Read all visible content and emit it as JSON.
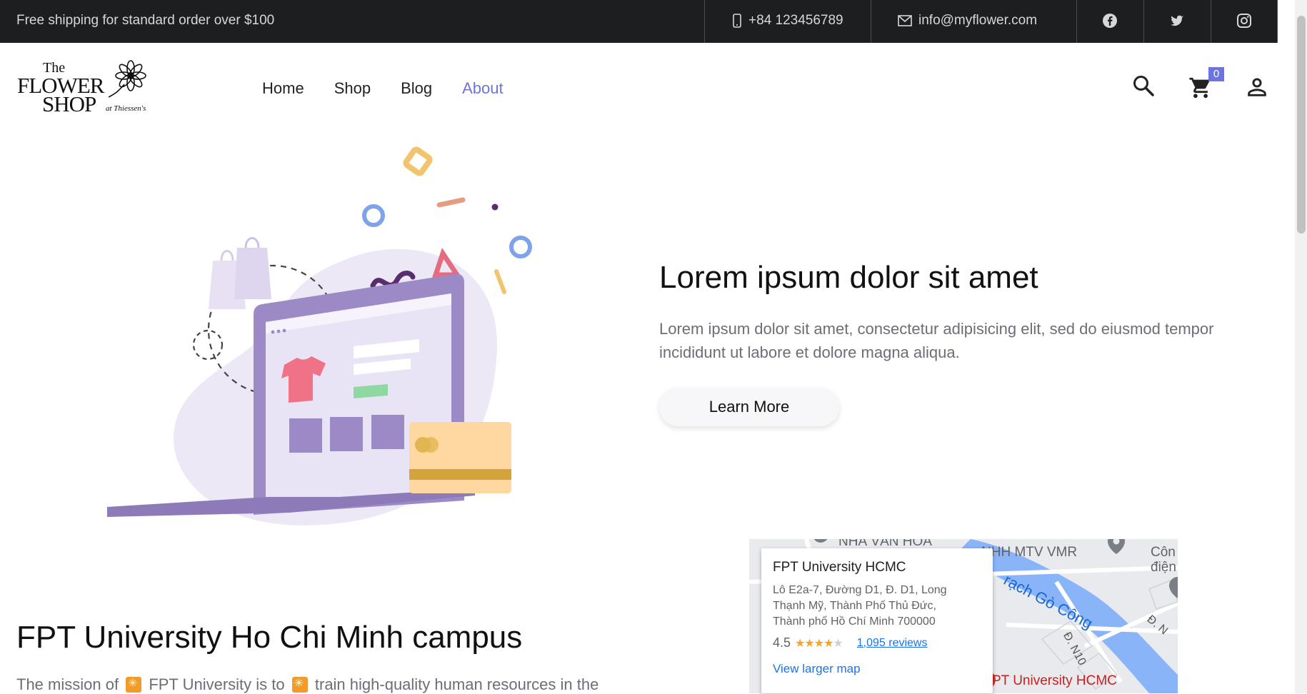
{
  "topbar": {
    "promo": "Free shipping for standard order over $100",
    "phone": "+84 123456789",
    "email": "info@myflower.com",
    "social_icons": [
      "facebook-icon",
      "twitter-icon",
      "instagram-icon"
    ]
  },
  "logo": {
    "line1": "The",
    "line2": "FLOWER",
    "line3": "SHOP",
    "line4": "at Thiessen's"
  },
  "nav": {
    "items": [
      "Home",
      "Shop",
      "Blog",
      "About"
    ],
    "active": "About",
    "active_color": "#6c74e0"
  },
  "header": {
    "icons": [
      "search-icon",
      "cart-icon",
      "user-icon"
    ],
    "cart_count": "0"
  },
  "hero": {
    "title": "Lorem ipsum dolor sit amet",
    "text": "Lorem ipsum dolor sit amet, consectetur adipisicing elit, sed do eiusmod tempor incididunt ut labore et dolore magna aliqua.",
    "button": "Learn More"
  },
  "campus": {
    "title": "FPT University Ho Chi Minh campus",
    "text_part1": "The mission of",
    "text_part2": "FPT University is to",
    "text_part3": "train high-quality human resources in the"
  },
  "map": {
    "place_name": "FPT University HCMC",
    "address": "Lô E2a-7, Đường D1, Đ. D1, Long Thạnh Mỹ, Thành Phố Thủ Đức, Thành phố Hồ Chí Minh 700000",
    "rating": "4.5",
    "reviews": "1,095 reviews",
    "larger_map": "View larger map",
    "labels": {
      "nha_van_hoa": "NHÀ VĂN HÓA",
      "company": "NHH MTV VMR",
      "cong": "Côn",
      "dien": "điện",
      "river": "rạch Gò Công",
      "road_n10": "Đ. N10",
      "road_n": "Đ. N",
      "marker": "PT University HCMC"
    }
  }
}
